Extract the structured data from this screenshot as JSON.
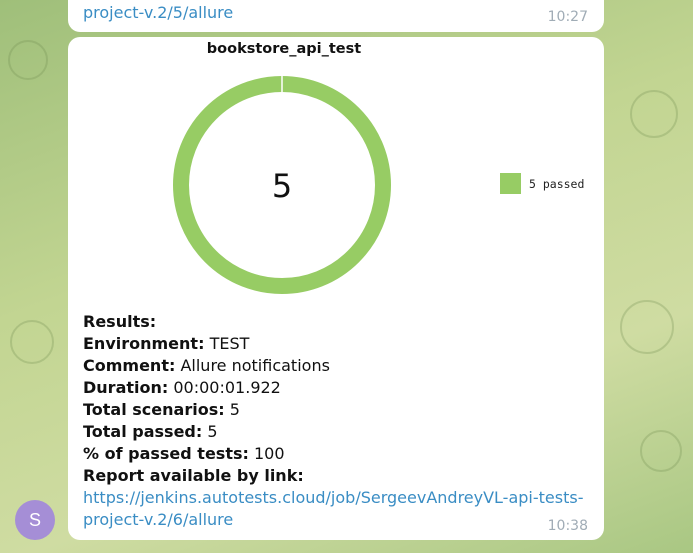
{
  "previous_message": {
    "link_tail": "project-v.2/5/allure",
    "time": "10:27"
  },
  "message": {
    "time": "10:38",
    "avatar_letter": "S"
  },
  "chart_data": {
    "type": "pie",
    "title": "bookstore_api_test",
    "center_label": "5",
    "slices": [
      {
        "name": "5 passed",
        "value": 5,
        "color": "#97cc64"
      }
    ],
    "legend_position": "right"
  },
  "results": {
    "heading": "Results:",
    "environment_label": "Environment:",
    "environment_value": "TEST",
    "comment_label": "Comment:",
    "comment_value": "Allure notifications",
    "duration_label": "Duration:",
    "duration_value": "00:00:01.922",
    "total_scenarios_label": "Total scenarios:",
    "total_scenarios_value": "5",
    "total_passed_label": "Total passed:",
    "total_passed_value": "5",
    "percent_label": "% of passed tests:",
    "percent_value": "100",
    "report_label": "Report available by link:",
    "report_link_line1": "https://jenkins.autotests.cloud/job/SergeevAndreyVL-api-tests-",
    "report_link_line2": "project-v.2/6/allure"
  },
  "colors": {
    "link": "#3a8dc4",
    "passed": "#97cc64",
    "avatar": "#a58ed6"
  }
}
